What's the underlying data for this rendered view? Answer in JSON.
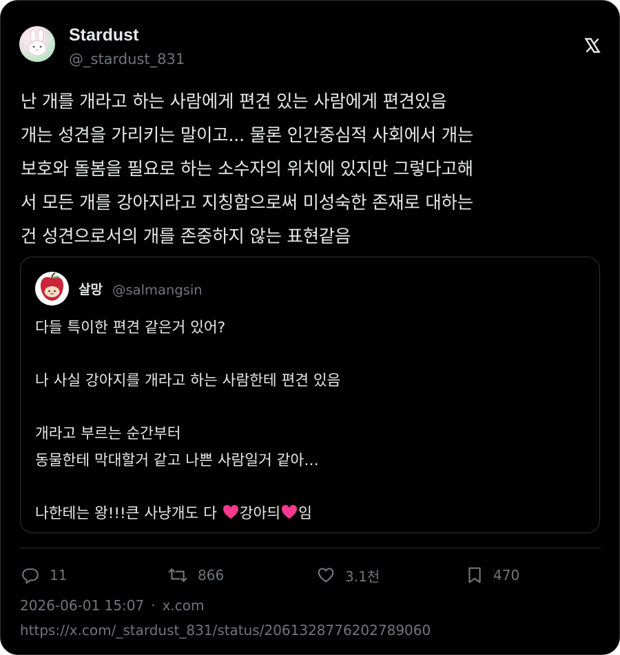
{
  "author": {
    "name": "Stardust",
    "handle": "@_stardust_831"
  },
  "tweet": {
    "text": "난 개를 개라고 하는 사람에게 편견 있는 사람에게 편견있음\n개는 성견을 가리키는 말이고... 물론 인간중심적 사회에서 개는\n보호와 돌봄을 필요로 하는 소수자의 위치에 있지만 그렇다고해\n서 모든 개를 강아지라고 지칭함으로써 미성숙한 존재로 대하는\n건 성견으로서의 개를 존중하지 않는 표현같음"
  },
  "quote": {
    "name": "살망",
    "handle": "@salmangsin",
    "lines": [
      "다들 특이한 편견 같은거 있어?",
      "",
      "나 사실 강아지를 개라고 하는 사람한테 편견 있음",
      "",
      "개라고 부르는 순간부터",
      "동물한테 막대할거 같고 나쁜 사람일거 같아…",
      ""
    ],
    "last_line": {
      "before": "나한테는 왕!!!큰 사냥개도 다 ",
      "middle": "강아듸",
      "after": "임",
      "heart_color": "#f7398d"
    }
  },
  "actions": {
    "replies": "11",
    "retweets": "866",
    "likes": "3.1천",
    "bookmarks": "470"
  },
  "meta": {
    "timestamp": "2026-06-01 15:07",
    "separator": "·",
    "source": "x.com",
    "url": "https://x.com/_stardust_831/status/2061328776202789060"
  },
  "icons": {
    "platform": "x-logo-icon",
    "reply": "reply-icon",
    "retweet": "retweet-icon",
    "like": "heart-icon",
    "bookmark": "bookmark-icon"
  },
  "colors": {
    "background": "#000000",
    "text": "#e7e9ea",
    "secondary": "#71767b",
    "border": "#2f3336"
  }
}
